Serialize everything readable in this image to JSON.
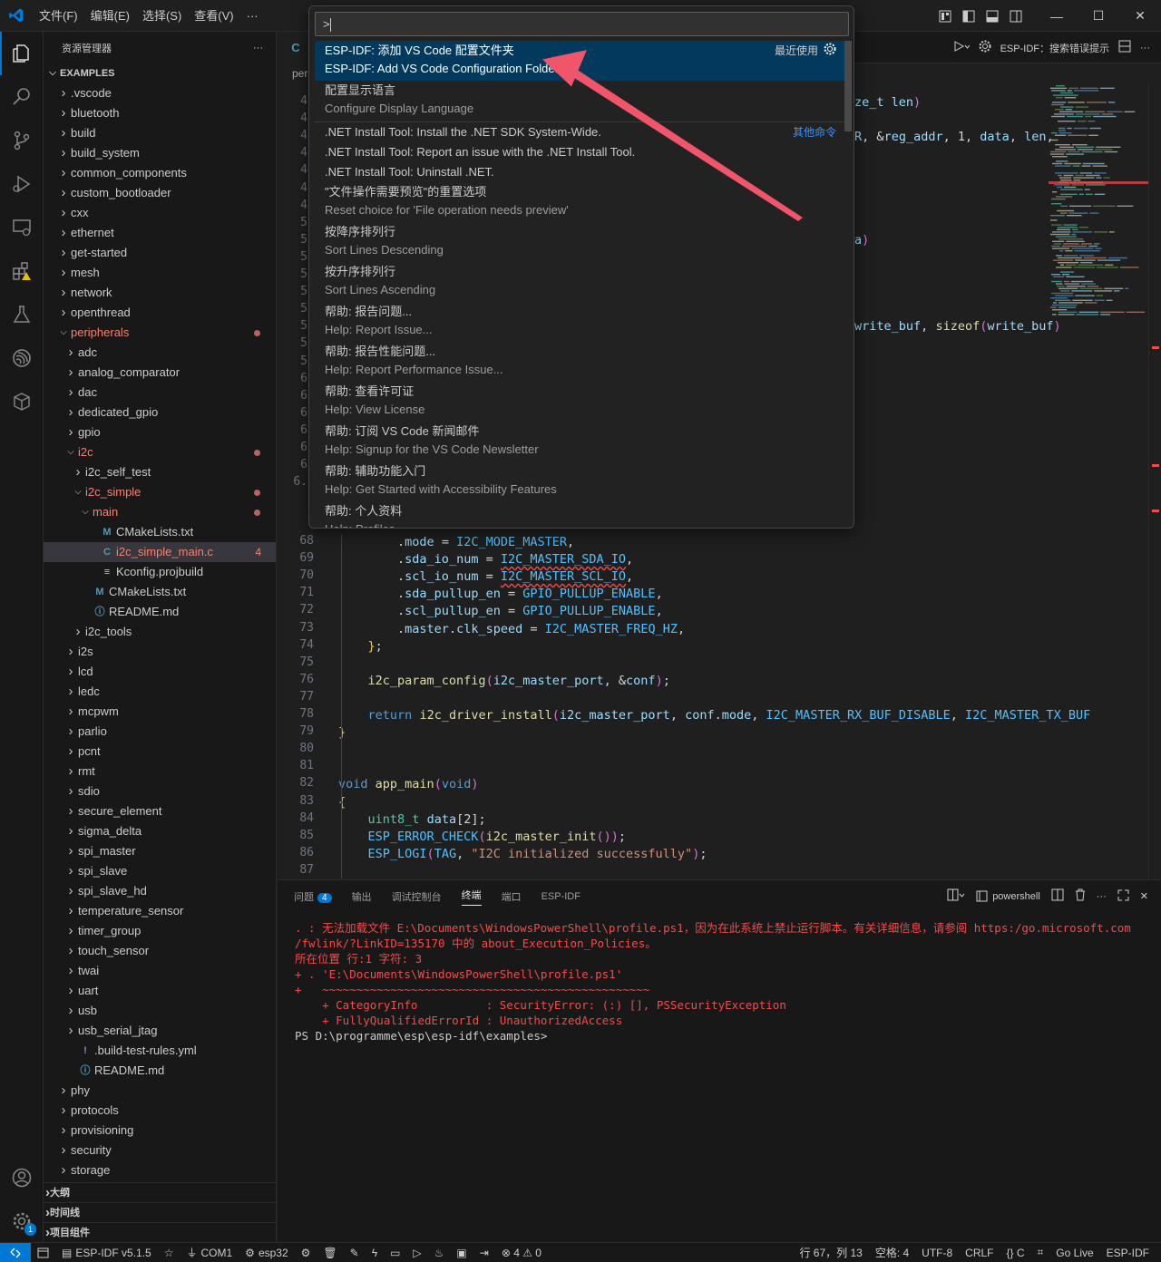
{
  "menu": [
    "文件(F)",
    "编辑(E)",
    "选择(S)",
    "查看(V)",
    "···"
  ],
  "sidebar": {
    "title": "资源管理器",
    "more": "···",
    "root": "EXAMPLES",
    "items": [
      {
        "label": ".vscode",
        "depth": 0,
        "kind": "folder",
        "open": false
      },
      {
        "label": "bluetooth",
        "depth": 0,
        "kind": "folder",
        "open": false
      },
      {
        "label": "build",
        "depth": 0,
        "kind": "folder",
        "open": false
      },
      {
        "label": "build_system",
        "depth": 0,
        "kind": "folder",
        "open": false
      },
      {
        "label": "common_components",
        "depth": 0,
        "kind": "folder",
        "open": false
      },
      {
        "label": "custom_bootloader",
        "depth": 0,
        "kind": "folder",
        "open": false
      },
      {
        "label": "cxx",
        "depth": 0,
        "kind": "folder",
        "open": false
      },
      {
        "label": "ethernet",
        "depth": 0,
        "kind": "folder",
        "open": false
      },
      {
        "label": "get-started",
        "depth": 0,
        "kind": "folder",
        "open": false
      },
      {
        "label": "mesh",
        "depth": 0,
        "kind": "folder",
        "open": false
      },
      {
        "label": "network",
        "depth": 0,
        "kind": "folder",
        "open": false
      },
      {
        "label": "openthread",
        "depth": 0,
        "kind": "folder",
        "open": false
      },
      {
        "label": "peripherals",
        "depth": 0,
        "kind": "folder",
        "open": true,
        "state": "err",
        "dot": true
      },
      {
        "label": "adc",
        "depth": 1,
        "kind": "folder",
        "open": false
      },
      {
        "label": "analog_comparator",
        "depth": 1,
        "kind": "folder",
        "open": false
      },
      {
        "label": "dac",
        "depth": 1,
        "kind": "folder",
        "open": false
      },
      {
        "label": "dedicated_gpio",
        "depth": 1,
        "kind": "folder",
        "open": false
      },
      {
        "label": "gpio",
        "depth": 1,
        "kind": "folder",
        "open": false
      },
      {
        "label": "i2c",
        "depth": 1,
        "kind": "folder",
        "open": true,
        "state": "err",
        "dot": true
      },
      {
        "label": "i2c_self_test",
        "depth": 2,
        "kind": "folder",
        "open": false
      },
      {
        "label": "i2c_simple",
        "depth": 2,
        "kind": "folder",
        "open": true,
        "state": "err",
        "dot": true
      },
      {
        "label": "main",
        "depth": 3,
        "kind": "folder",
        "open": true,
        "state": "err",
        "dot": true
      },
      {
        "label": "CMakeLists.txt",
        "depth": 4,
        "kind": "cmake"
      },
      {
        "label": "i2c_simple_main.c",
        "depth": 4,
        "kind": "c",
        "state": "err",
        "sel": true,
        "count": "4"
      },
      {
        "label": "Kconfig.projbuild",
        "depth": 4,
        "kind": "lines"
      },
      {
        "label": "CMakeLists.txt",
        "depth": 3,
        "kind": "cmake"
      },
      {
        "label": "README.md",
        "depth": 3,
        "kind": "info"
      },
      {
        "label": "i2c_tools",
        "depth": 2,
        "kind": "folder",
        "open": false
      },
      {
        "label": "i2s",
        "depth": 1,
        "kind": "folder",
        "open": false
      },
      {
        "label": "lcd",
        "depth": 1,
        "kind": "folder",
        "open": false
      },
      {
        "label": "ledc",
        "depth": 1,
        "kind": "folder",
        "open": false
      },
      {
        "label": "mcpwm",
        "depth": 1,
        "kind": "folder",
        "open": false
      },
      {
        "label": "parlio",
        "depth": 1,
        "kind": "folder",
        "open": false
      },
      {
        "label": "pcnt",
        "depth": 1,
        "kind": "folder",
        "open": false
      },
      {
        "label": "rmt",
        "depth": 1,
        "kind": "folder",
        "open": false
      },
      {
        "label": "sdio",
        "depth": 1,
        "kind": "folder",
        "open": false
      },
      {
        "label": "secure_element",
        "depth": 1,
        "kind": "folder",
        "open": false
      },
      {
        "label": "sigma_delta",
        "depth": 1,
        "kind": "folder",
        "open": false
      },
      {
        "label": "spi_master",
        "depth": 1,
        "kind": "folder",
        "open": false
      },
      {
        "label": "spi_slave",
        "depth": 1,
        "kind": "folder",
        "open": false
      },
      {
        "label": "spi_slave_hd",
        "depth": 1,
        "kind": "folder",
        "open": false
      },
      {
        "label": "temperature_sensor",
        "depth": 1,
        "kind": "folder",
        "open": false
      },
      {
        "label": "timer_group",
        "depth": 1,
        "kind": "folder",
        "open": false
      },
      {
        "label": "touch_sensor",
        "depth": 1,
        "kind": "folder",
        "open": false
      },
      {
        "label": "twai",
        "depth": 1,
        "kind": "folder",
        "open": false
      },
      {
        "label": "uart",
        "depth": 1,
        "kind": "folder",
        "open": false
      },
      {
        "label": "usb",
        "depth": 1,
        "kind": "folder",
        "open": false
      },
      {
        "label": "usb_serial_jtag",
        "depth": 1,
        "kind": "folder",
        "open": false
      },
      {
        "label": ".build-test-rules.yml",
        "depth": 1,
        "kind": "yml"
      },
      {
        "label": "README.md",
        "depth": 1,
        "kind": "info"
      },
      {
        "label": "phy",
        "depth": 0,
        "kind": "folder",
        "open": false
      },
      {
        "label": "protocols",
        "depth": 0,
        "kind": "folder",
        "open": false
      },
      {
        "label": "provisioning",
        "depth": 0,
        "kind": "folder",
        "open": false
      },
      {
        "label": "security",
        "depth": 0,
        "kind": "folder",
        "open": false
      },
      {
        "label": "storage",
        "depth": 0,
        "kind": "folder",
        "open": false
      }
    ],
    "sections": [
      "大纲",
      "时间线",
      "项目组件"
    ]
  },
  "editor": {
    "tab_icon": "C",
    "breadcrumb": "per",
    "actions": {
      "title": "ESP-IDF：搜索错误提示"
    },
    "partial_right": [
      {
        "text": "ze_t len)"
      },
      {
        "text": "R, &reg_addr, 1, data, len,"
      },
      {
        "text": "a)"
      },
      {
        "text": "write_buf, sizeof(write_buf)"
      }
    ],
    "hidden_line_numbers": [
      "4",
      "4",
      "4",
      "4",
      "4",
      "4",
      "4",
      "5",
      "5",
      "5",
      "5",
      "5",
      "5",
      "5",
      "5",
      "5",
      "6",
      "6",
      "6",
      "6",
      "6",
      "6",
      "6."
    ],
    "lines": [
      {
        "n": "68",
        "text": "        .mode = I2C_MODE_MASTER,"
      },
      {
        "n": "69",
        "text": "        .sda_io_num = I2C_MASTER_SDA_IO,"
      },
      {
        "n": "70",
        "text": "        .scl_io_num = I2C_MASTER_SCL_IO,"
      },
      {
        "n": "71",
        "text": "        .sda_pullup_en = GPIO_PULLUP_ENABLE,"
      },
      {
        "n": "72",
        "text": "        .scl_pullup_en = GPIO_PULLUP_ENABLE,"
      },
      {
        "n": "73",
        "text": "        .master.clk_speed = I2C_MASTER_FREQ_HZ,"
      },
      {
        "n": "74",
        "text": "    };"
      },
      {
        "n": "75",
        "text": ""
      },
      {
        "n": "76",
        "text": "    i2c_param_config(i2c_master_port, &conf);"
      },
      {
        "n": "77",
        "text": ""
      },
      {
        "n": "78",
        "text": "    return i2c_driver_install(i2c_master_port, conf.mode, I2C_MASTER_RX_BUF_DISABLE, I2C_MASTER_TX_BUF"
      },
      {
        "n": "79",
        "text": "}"
      },
      {
        "n": "80",
        "text": ""
      },
      {
        "n": "81",
        "text": ""
      },
      {
        "n": "82",
        "text": "void app_main(void)"
      },
      {
        "n": "83",
        "text": "{"
      },
      {
        "n": "84",
        "text": "    uint8_t data[2];"
      },
      {
        "n": "85",
        "text": "    ESP_ERROR_CHECK(i2c_master_init());"
      },
      {
        "n": "86",
        "text": "    ESP_LOGI(TAG, \"I2C initialized successfully\");"
      },
      {
        "n": "87",
        "text": ""
      }
    ]
  },
  "palette": {
    "input": ">",
    "items": [
      {
        "l1": "ESP-IDF: 添加 VS Code 配置文件夹",
        "l2": "ESP-IDF: Add VS Code Configuration Folder",
        "tag": "最近使用",
        "focus": true
      },
      {
        "l1": "配置显示语言",
        "l2": "Configure Display Language"
      },
      {
        "l1": ".NET Install Tool: Install the .NET SDK System-Wide.",
        "tag": "其他命令",
        "tagLink": true,
        "sep": true
      },
      {
        "l1": ".NET Install Tool: Report an issue with the .NET Install Tool."
      },
      {
        "l1": ".NET Install Tool: Uninstall .NET."
      },
      {
        "l1": "\"文件操作需要预览\"的重置选项",
        "l2": "Reset choice for 'File operation needs preview'"
      },
      {
        "l1": "按降序排列行",
        "l2": "Sort Lines Descending"
      },
      {
        "l1": "按升序排列行",
        "l2": "Sort Lines Ascending"
      },
      {
        "l1": "帮助: 报告问题...",
        "l2": "Help: Report Issue..."
      },
      {
        "l1": "帮助: 报告性能问题...",
        "l2": "Help: Report Performance Issue..."
      },
      {
        "l1": "帮助: 查看许可证",
        "l2": "Help: View License"
      },
      {
        "l1": "帮助: 订阅 VS Code 新闻邮件",
        "l2": "Help: Signup for the VS Code Newsletter"
      },
      {
        "l1": "帮助: 辅助功能入门",
        "l2": "Help: Get Started with Accessibility Features"
      },
      {
        "l1": "帮助: 个人资料",
        "l2": "Help: Profiles"
      }
    ]
  },
  "panel": {
    "tabs": [
      {
        "label": "问题",
        "badge": "4"
      },
      {
        "label": "输出"
      },
      {
        "label": "调试控制台"
      },
      {
        "label": "终端",
        "active": true
      },
      {
        "label": "端口"
      },
      {
        "label": "ESP-IDF"
      }
    ],
    "shell": "powershell",
    "terminal": [
      {
        "text": ". : 无法加载文件 E:\\Documents\\WindowsPowerShell\\profile.ps1，因为在此系统上禁止运行脚本。有关详细信息，请参阅 https:/go.microsoft.com",
        "err": true
      },
      {
        "text": "/fwlink/?LinkID=135170 中的 about_Execution_Policies。",
        "err": true
      },
      {
        "text": "所在位置 行:1 字符: 3",
        "err": true
      },
      {
        "text": "+ . 'E:\\Documents\\WindowsPowerShell\\profile.ps1'",
        "err": true
      },
      {
        "text": "+   ~~~~~~~~~~~~~~~~~~~~~~~~~~~~~~~~~~~~~~~~~~~~~~~~",
        "err": true
      },
      {
        "text": "    + CategoryInfo          : SecurityError: (:) [], PSSecurityException",
        "err": true
      },
      {
        "text": "    + FullyQualifiedErrorId : UnauthorizedAccess",
        "err": true
      },
      {
        "text": "PS D:\\programme\\esp\\esp-idf\\examples>",
        "err": false
      }
    ]
  },
  "statusbar": {
    "items": [
      {
        "icon": "db-icon",
        "label": "ESP-IDF v5.1.5"
      },
      {
        "icon": "star-icon",
        "label": ""
      },
      {
        "icon": "plug-icon",
        "label": "COM1"
      },
      {
        "icon": "chip-icon",
        "label": "esp32"
      },
      {
        "icon": "gear-icon",
        "label": ""
      },
      {
        "icon": "trash-icon",
        "label": ""
      },
      {
        "icon": "wrench-icon",
        "label": ""
      },
      {
        "icon": "flash-icon",
        "label": ""
      },
      {
        "icon": "monitor-icon",
        "label": ""
      },
      {
        "icon": "debug-icon",
        "label": ""
      },
      {
        "icon": "fire-icon",
        "label": ""
      },
      {
        "icon": "terminal-icon",
        "label": ""
      },
      {
        "icon": "run-icon",
        "label": ""
      },
      {
        "icon": "problems-icon",
        "label": "⊗ 4 ⚠ 0"
      }
    ],
    "right": [
      "行 67，列 13",
      "空格: 4",
      "UTF-8",
      "CRLF",
      "{} C",
      "⌗",
      "Go Live",
      "ESP-IDF"
    ]
  },
  "colors": {
    "accent": "#0078d4",
    "error": "#f14c4c",
    "modified": "#e2c08d"
  }
}
